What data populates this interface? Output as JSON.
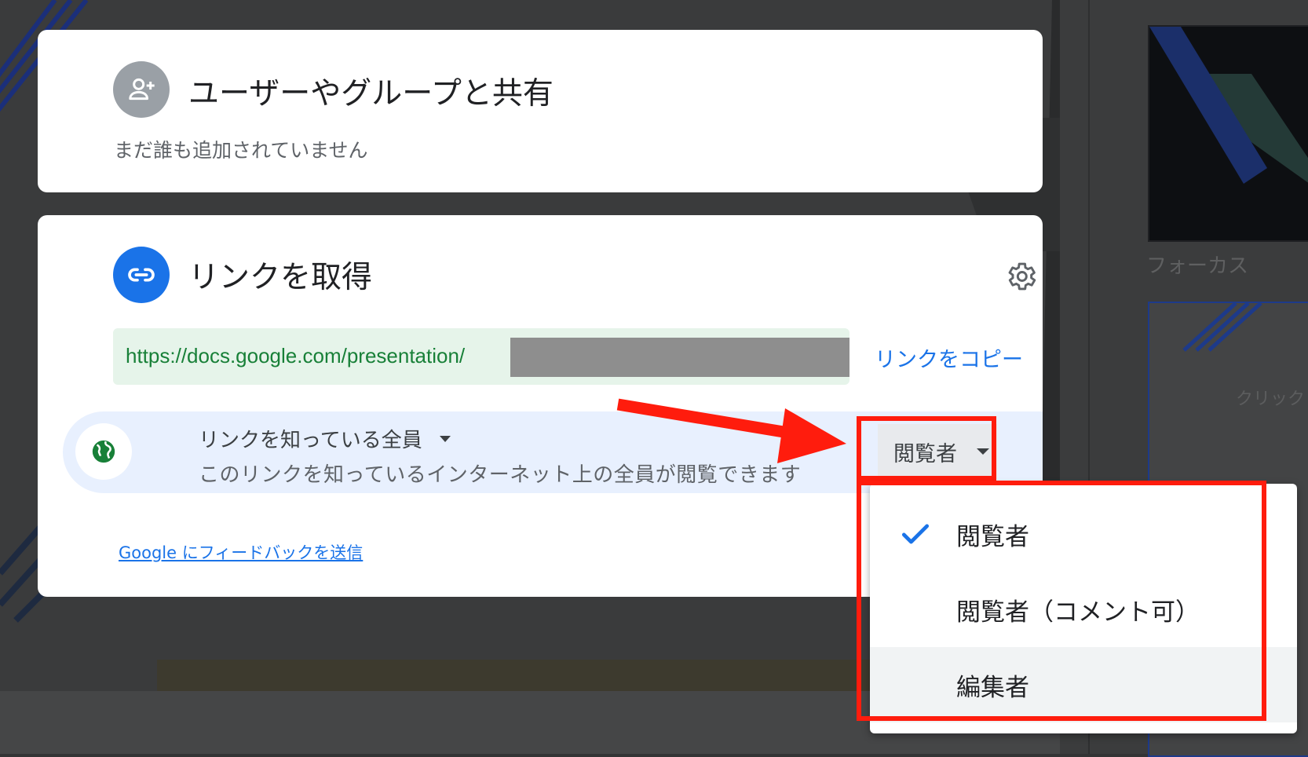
{
  "share_card": {
    "title": "ユーザーやグループと共有",
    "subtitle": "まだ誰も追加されていません"
  },
  "link_card": {
    "title": "リンクを取得",
    "url": "https://docs.google.com/presentation/",
    "copy_link_label": "リンクをコピー",
    "access": {
      "scope_label": "リンクを知っている全員",
      "description": "このリンクを知っているインターネット上の全員が閲覧できます",
      "role_selected": "閲覧者"
    },
    "feedback_link": "Google にフィードバックを送信"
  },
  "role_menu": {
    "items": [
      {
        "label": "閲覧者",
        "checked": true
      },
      {
        "label": "閲覧者（コメント可）",
        "checked": false
      },
      {
        "label": "編集者",
        "checked": false
      }
    ]
  },
  "background": {
    "thumbnail_label": "フォーカス",
    "thumbnail_text": "クリックし"
  },
  "colors": {
    "accent_blue": "#1a73e8",
    "url_green": "#188038",
    "globe_green": "#188038",
    "annotation_red": "#ff1c0d"
  },
  "icons": {
    "share": "person-add-icon",
    "link": "link-icon",
    "settings": "gear-icon",
    "globe": "globe-icon",
    "check": "check-icon"
  }
}
